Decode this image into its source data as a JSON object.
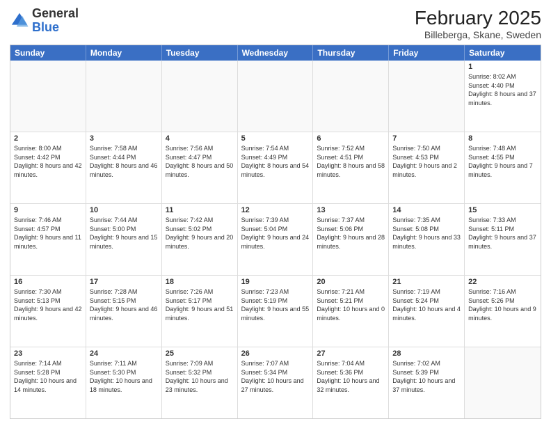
{
  "logo": {
    "general": "General",
    "blue": "Blue"
  },
  "header": {
    "month": "February 2025",
    "location": "Billeberga, Skane, Sweden"
  },
  "weekdays": [
    "Sunday",
    "Monday",
    "Tuesday",
    "Wednesday",
    "Thursday",
    "Friday",
    "Saturday"
  ],
  "rows": [
    [
      {
        "day": "",
        "info": ""
      },
      {
        "day": "",
        "info": ""
      },
      {
        "day": "",
        "info": ""
      },
      {
        "day": "",
        "info": ""
      },
      {
        "day": "",
        "info": ""
      },
      {
        "day": "",
        "info": ""
      },
      {
        "day": "1",
        "info": "Sunrise: 8:02 AM\nSunset: 4:40 PM\nDaylight: 8 hours and 37 minutes."
      }
    ],
    [
      {
        "day": "2",
        "info": "Sunrise: 8:00 AM\nSunset: 4:42 PM\nDaylight: 8 hours and 42 minutes."
      },
      {
        "day": "3",
        "info": "Sunrise: 7:58 AM\nSunset: 4:44 PM\nDaylight: 8 hours and 46 minutes."
      },
      {
        "day": "4",
        "info": "Sunrise: 7:56 AM\nSunset: 4:47 PM\nDaylight: 8 hours and 50 minutes."
      },
      {
        "day": "5",
        "info": "Sunrise: 7:54 AM\nSunset: 4:49 PM\nDaylight: 8 hours and 54 minutes."
      },
      {
        "day": "6",
        "info": "Sunrise: 7:52 AM\nSunset: 4:51 PM\nDaylight: 8 hours and 58 minutes."
      },
      {
        "day": "7",
        "info": "Sunrise: 7:50 AM\nSunset: 4:53 PM\nDaylight: 9 hours and 2 minutes."
      },
      {
        "day": "8",
        "info": "Sunrise: 7:48 AM\nSunset: 4:55 PM\nDaylight: 9 hours and 7 minutes."
      }
    ],
    [
      {
        "day": "9",
        "info": "Sunrise: 7:46 AM\nSunset: 4:57 PM\nDaylight: 9 hours and 11 minutes."
      },
      {
        "day": "10",
        "info": "Sunrise: 7:44 AM\nSunset: 5:00 PM\nDaylight: 9 hours and 15 minutes."
      },
      {
        "day": "11",
        "info": "Sunrise: 7:42 AM\nSunset: 5:02 PM\nDaylight: 9 hours and 20 minutes."
      },
      {
        "day": "12",
        "info": "Sunrise: 7:39 AM\nSunset: 5:04 PM\nDaylight: 9 hours and 24 minutes."
      },
      {
        "day": "13",
        "info": "Sunrise: 7:37 AM\nSunset: 5:06 PM\nDaylight: 9 hours and 28 minutes."
      },
      {
        "day": "14",
        "info": "Sunrise: 7:35 AM\nSunset: 5:08 PM\nDaylight: 9 hours and 33 minutes."
      },
      {
        "day": "15",
        "info": "Sunrise: 7:33 AM\nSunset: 5:11 PM\nDaylight: 9 hours and 37 minutes."
      }
    ],
    [
      {
        "day": "16",
        "info": "Sunrise: 7:30 AM\nSunset: 5:13 PM\nDaylight: 9 hours and 42 minutes."
      },
      {
        "day": "17",
        "info": "Sunrise: 7:28 AM\nSunset: 5:15 PM\nDaylight: 9 hours and 46 minutes."
      },
      {
        "day": "18",
        "info": "Sunrise: 7:26 AM\nSunset: 5:17 PM\nDaylight: 9 hours and 51 minutes."
      },
      {
        "day": "19",
        "info": "Sunrise: 7:23 AM\nSunset: 5:19 PM\nDaylight: 9 hours and 55 minutes."
      },
      {
        "day": "20",
        "info": "Sunrise: 7:21 AM\nSunset: 5:21 PM\nDaylight: 10 hours and 0 minutes."
      },
      {
        "day": "21",
        "info": "Sunrise: 7:19 AM\nSunset: 5:24 PM\nDaylight: 10 hours and 4 minutes."
      },
      {
        "day": "22",
        "info": "Sunrise: 7:16 AM\nSunset: 5:26 PM\nDaylight: 10 hours and 9 minutes."
      }
    ],
    [
      {
        "day": "23",
        "info": "Sunrise: 7:14 AM\nSunset: 5:28 PM\nDaylight: 10 hours and 14 minutes."
      },
      {
        "day": "24",
        "info": "Sunrise: 7:11 AM\nSunset: 5:30 PM\nDaylight: 10 hours and 18 minutes."
      },
      {
        "day": "25",
        "info": "Sunrise: 7:09 AM\nSunset: 5:32 PM\nDaylight: 10 hours and 23 minutes."
      },
      {
        "day": "26",
        "info": "Sunrise: 7:07 AM\nSunset: 5:34 PM\nDaylight: 10 hours and 27 minutes."
      },
      {
        "day": "27",
        "info": "Sunrise: 7:04 AM\nSunset: 5:36 PM\nDaylight: 10 hours and 32 minutes."
      },
      {
        "day": "28",
        "info": "Sunrise: 7:02 AM\nSunset: 5:39 PM\nDaylight: 10 hours and 37 minutes."
      },
      {
        "day": "",
        "info": ""
      }
    ]
  ]
}
